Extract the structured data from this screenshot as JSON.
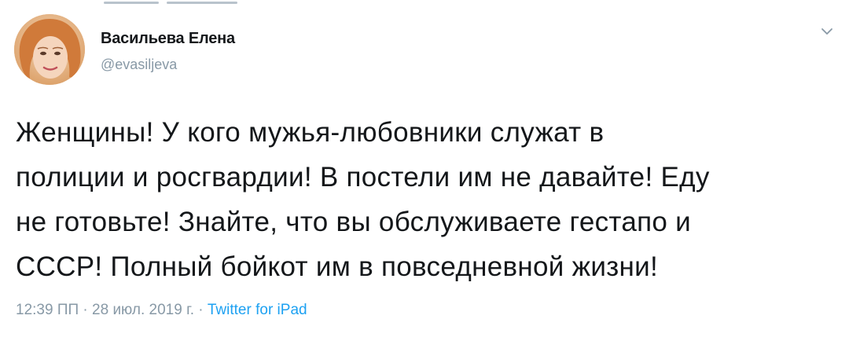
{
  "tweet": {
    "author_name": "Васильева Елена",
    "author_handle": "@evasiljeva",
    "text": "Женщины! У кого мужья-любовники служат в\nполиции и росгвардии! В постели им не давайте! Еду\nне готовьте! Знайте, что вы обслуживаете гестапо и\nСССР! Полный бойкот им в повседневной жизни!",
    "time": "12:39 ПП",
    "separator": " · ",
    "date": "28 июл. 2019 г.",
    "source": "Twitter for iPad"
  },
  "icons": {
    "avatar": "avatar-photo",
    "menu": "chevron-down-icon"
  },
  "colors": {
    "text": "#14171a",
    "secondary": "#8899a6",
    "link": "#1da1f2",
    "background": "#ffffff"
  }
}
